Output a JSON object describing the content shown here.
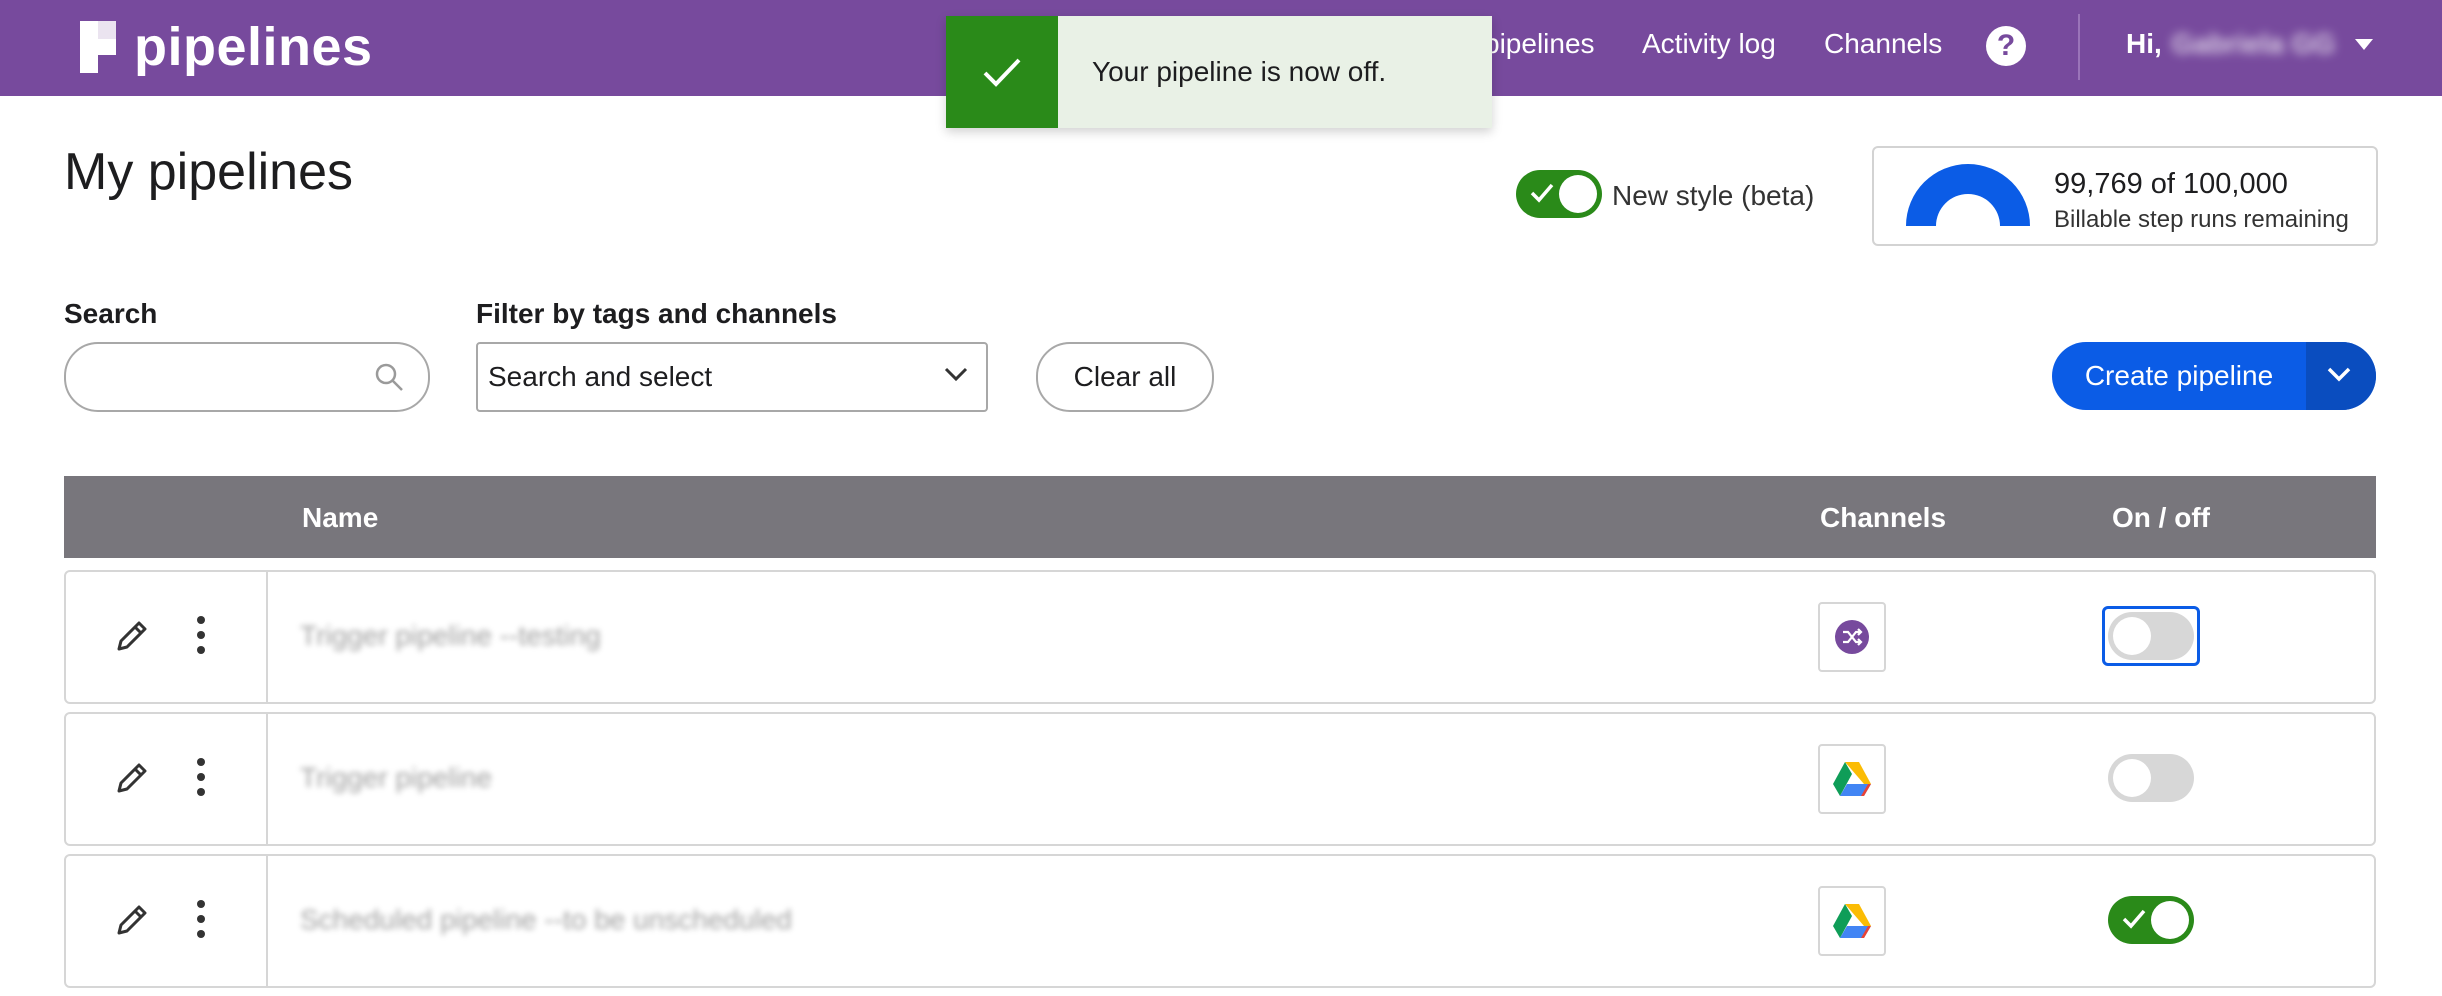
{
  "app": {
    "logo_text": "pipelines"
  },
  "nav": {
    "items": [
      "pipelines",
      "Activity log",
      "Channels"
    ],
    "help_glyph": "?",
    "greeting": "Hi,",
    "user_name": "Gabriela GG"
  },
  "toast": {
    "message": "Your pipeline is now off.",
    "color": "#2a8a19"
  },
  "header": {
    "title": "My pipelines",
    "beta_toggle_label": "New style (beta)",
    "beta_toggle_on": true,
    "usage_count": "99,769 of 100,000",
    "usage_label": "Billable step runs remaining",
    "usage_fraction": 0.99769
  },
  "filters": {
    "search_label": "Search",
    "search_value": "",
    "search_placeholder": "",
    "tags_label": "Filter by tags and channels",
    "tags_value": "Search and select",
    "clear_label": "Clear all",
    "create_label": "Create pipeline"
  },
  "table": {
    "headers": {
      "name": "Name",
      "channels": "Channels",
      "onoff": "On / off"
    },
    "rows": [
      {
        "name": "Trigger pipeline --testing",
        "channel_icon": "shuffle-icon",
        "on": false
      },
      {
        "name": "Trigger pipeline",
        "channel_icon": "google-drive-icon",
        "on": false
      },
      {
        "name": "Scheduled pipeline --to be unscheduled",
        "channel_icon": "google-drive-icon",
        "on": true
      }
    ]
  },
  "colors": {
    "brand": "#774a9d",
    "primary": "#0b5ce6",
    "success": "#2a8a19",
    "table_header": "#78767c"
  }
}
